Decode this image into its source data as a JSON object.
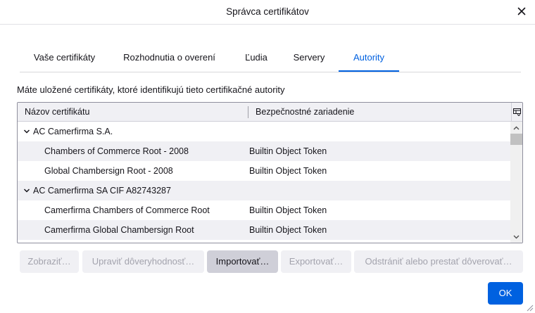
{
  "window": {
    "title": "Správca certifikátov",
    "close_label": "✕"
  },
  "tabs": [
    {
      "label": "Vaše certifikáty",
      "selected": false
    },
    {
      "label": "Rozhodnutia o overení",
      "selected": false
    },
    {
      "label": "Ľudia",
      "selected": false
    },
    {
      "label": "Servery",
      "selected": false
    },
    {
      "label": "Autority",
      "selected": true
    }
  ],
  "description": "Máte uložené certifikáty, ktoré identifikujú tieto certifikačné autority",
  "tree": {
    "columns": [
      "Názov certifikátu",
      "Bezpečnostné zariadenie"
    ],
    "rows": [
      {
        "name": "AC Camerfirma S.A.",
        "device": "",
        "type": "group",
        "expanded": true
      },
      {
        "name": "Chambers of Commerce Root - 2008",
        "device": "Builtin Object Token",
        "type": "cert"
      },
      {
        "name": "Global Chambersign Root - 2008",
        "device": "Builtin Object Token",
        "type": "cert"
      },
      {
        "name": "AC Camerfirma SA CIF A82743287",
        "device": "",
        "type": "group",
        "expanded": true
      },
      {
        "name": "Camerfirma Chambers of Commerce Root",
        "device": "Builtin Object Token",
        "type": "cert"
      },
      {
        "name": "Camerfirma Global Chambersign Root",
        "device": "Builtin Object Token",
        "type": "cert"
      }
    ]
  },
  "buttons": {
    "view": "Zobraziť…",
    "edit_trust": "Upraviť dôveryhodnosť…",
    "import": "Importovať…",
    "export": "Exportovať…",
    "delete": "Odstrániť alebo prestať dôverovať…",
    "ok": "OK"
  },
  "colors": {
    "accent": "#0061e0",
    "row_alt": "#f0f0f4",
    "disabled_text": "#a3a3ad"
  }
}
